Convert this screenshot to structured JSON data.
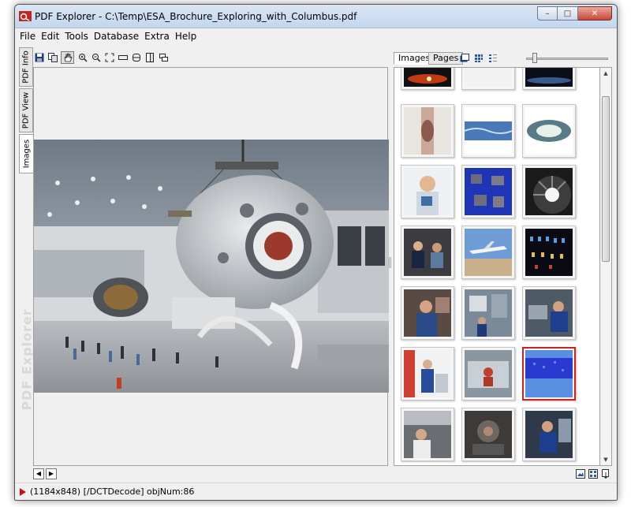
{
  "window": {
    "title": "PDF Explorer - C:\\Temp\\ESA_Brochure_Exploring_with_Columbus.pdf",
    "minimize_glyph": "–",
    "maximize_glyph": "□",
    "close_glyph": "✕"
  },
  "menu": {
    "items": [
      "File",
      "Edit",
      "Tools",
      "Database",
      "Extra",
      "Help"
    ]
  },
  "left_tabs": {
    "items": [
      "PDF Info",
      "PDF View",
      "Images"
    ],
    "active": "Images",
    "brand_watermark": "PDF Explorer"
  },
  "right_panel": {
    "tabs": [
      "Images",
      "Pages"
    ],
    "active_tab": "Images",
    "icons": [
      "image-view-icon",
      "grid-view-icon",
      "list-view-icon"
    ],
    "zoom_slider_value": 0.1,
    "selected_thumbnail_row": 5,
    "selected_thumbnail_col": 2
  },
  "status": {
    "text": "(1184x848) [/DCTDecode] objNum:86"
  },
  "colors": {
    "accent_selected": "#d02020",
    "status_icon": "#d01010",
    "titlebar": "#c3d6ee"
  }
}
